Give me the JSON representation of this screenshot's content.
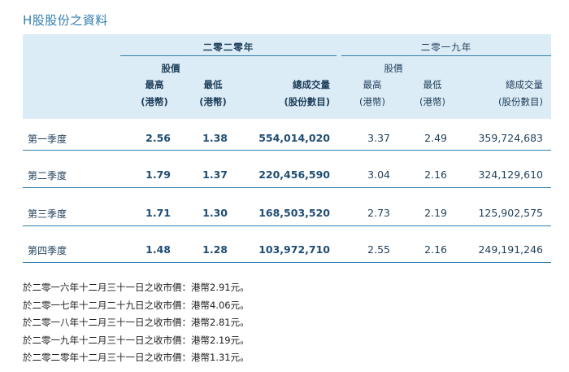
{
  "title": "H股股份之資料",
  "years": {
    "y2020": "二零二零年",
    "y2019": "二零一九年"
  },
  "headers": {
    "price": "股價",
    "high": "最高",
    "low": "最低",
    "unit_hkd": "(港幣)",
    "volume": "總成交量",
    "volume_unit": "(股份數目)"
  },
  "rows": [
    {
      "label": "第一季度",
      "h2020": "2.56",
      "l2020": "1.38",
      "v2020": "554,014,020",
      "h2019": "3.37",
      "l2019": "2.49",
      "v2019": "359,724,683"
    },
    {
      "label": "第二季度",
      "h2020": "1.79",
      "l2020": "1.37",
      "v2020": "220,456,590",
      "h2019": "3.04",
      "l2019": "2.16",
      "v2019": "324,129,610"
    },
    {
      "label": "第三季度",
      "h2020": "1.71",
      "l2020": "1.30",
      "v2020": "168,503,520",
      "h2019": "2.73",
      "l2019": "2.19",
      "v2019": "125,902,575"
    },
    {
      "label": "第四季度",
      "h2020": "1.48",
      "l2020": "1.28",
      "v2020": "103,972,710",
      "h2019": "2.55",
      "l2019": "2.16",
      "v2019": "249,191,246"
    }
  ],
  "notes": [
    "於二零一六年十二月三十一日之收市價：港幣2.91元。",
    "於二零一七年十二月二十九日之收市價：港幣4.06元。",
    "於二零一八年十二月三十一日之收市價：港幣2.81元。",
    "於二零一九年十二月三十一日之收市價：港幣2.19元。",
    "於二零二零年十二月三十一日之收市價：港幣1.31元。"
  ]
}
